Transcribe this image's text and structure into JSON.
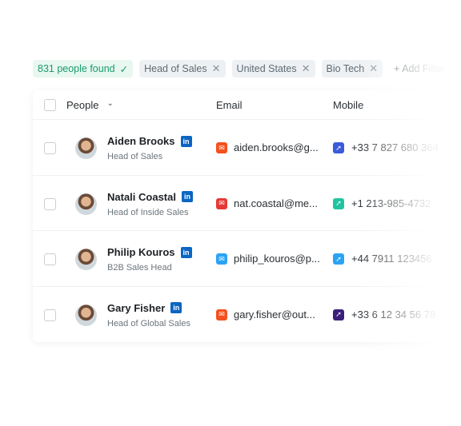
{
  "filters": {
    "found": "831 people found",
    "found_icon": "check-icon",
    "chips": [
      "Head of Sales",
      "United States",
      "Bio Tech"
    ],
    "add": "+ Add Filter"
  },
  "header": {
    "people": "People",
    "email": "Email",
    "mobile": "Mobile"
  },
  "rows": [
    {
      "name": "Aiden Brooks",
      "title": "Head of Sales",
      "email": "aiden.brooks@g...",
      "mobile": "+33 7 827 680 364",
      "email_icon_color": "#f4511e",
      "mobile_icon_color": "#3b5bdb"
    },
    {
      "name": "Natali Coastal",
      "title": "Head of Inside Sales",
      "email": "nat.coastal@me...",
      "mobile": "+1 213-985-4732",
      "email_icon_color": "#e53935",
      "mobile_icon_color": "#20c4a0"
    },
    {
      "name": "Philip Kouros",
      "title": "B2B Sales Head",
      "email": "philip_kouros@p...",
      "mobile": "+44 7911 123456",
      "email_icon_color": "#2aa3f5",
      "mobile_icon_color": "#2aa3f5"
    },
    {
      "name": "Gary Fisher",
      "title": "Head of Global Sales",
      "email": "gary.fisher@out...",
      "mobile": "+33 6 12 34 56 78",
      "email_icon_color": "#f4511e",
      "mobile_icon_color": "#3b1f7a"
    }
  ]
}
